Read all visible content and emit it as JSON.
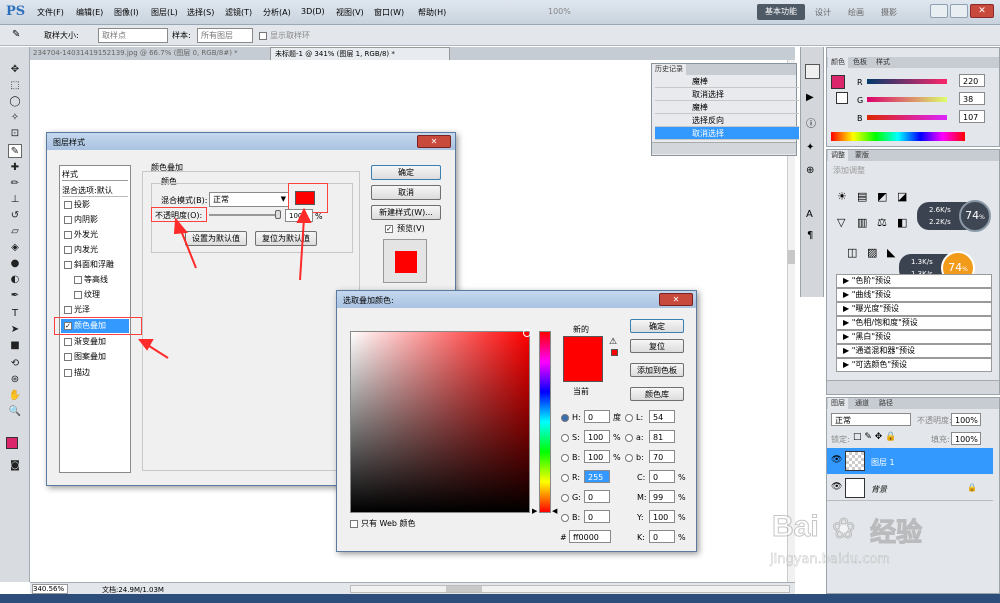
{
  "app": {
    "logo": "PS"
  },
  "menu": [
    "文件(F)",
    "编辑(E)",
    "图像(I)",
    "图层(L)",
    "选择(S)",
    "滤镜(T)",
    "分析(A)",
    "3D(D)",
    "视图(V)",
    "窗口(W)",
    "帮助(H)"
  ],
  "menubar_right": {
    "zoom": "100%",
    "workspaces": [
      "基本功能",
      "设计",
      "绘画",
      "摄影"
    ]
  },
  "options_bar": {
    "sample_size_label": "取样大小:",
    "sample_size_value": "取样点",
    "sample_label": "样本:",
    "sample_value": "所有图层",
    "show_ring": "显示取样环"
  },
  "doc_tabs": [
    "234704-14031419152139.jpg @ 66.7% (图层 0, RGB/8#) *",
    "未标题-1 @ 341% (图层 1, RGB/8) *"
  ],
  "history": {
    "tabs": [
      "历史记录"
    ],
    "items": [
      "魔棒",
      "取消选择",
      "魔棒",
      "选择反向",
      "取消选择"
    ]
  },
  "color_panel": {
    "tabs": [
      "颜色",
      "色板",
      "样式"
    ],
    "r_label": "R",
    "g_label": "G",
    "b_label": "B",
    "r": "220",
    "g": "38",
    "b": "107",
    "fg_color": "#dc266b"
  },
  "adjust_panel": {
    "tabs": [
      "调整",
      "蒙版"
    ],
    "hint": "添加调整",
    "net_up": "2.6K/s",
    "net_down": "2.2K/s",
    "net_up2": "1.3K/s",
    "net_down2": "1.3K/s",
    "pct": "74",
    "pct_sign": "%",
    "presets": [
      "\"色阶\"预设",
      "\"曲线\"预设",
      "\"曝光度\"预设",
      "\"色相/饱和度\"预设",
      "\"黑白\"预设",
      "\"通道混和器\"预设",
      "\"可选颜色\"预设"
    ]
  },
  "layers_panel": {
    "tabs": [
      "图层",
      "通道",
      "路径"
    ],
    "mode": "正常",
    "opacity_label": "不透明度:",
    "opacity": "100%",
    "lock_label": "锁定:",
    "fill_label": "填充:",
    "fill": "100%",
    "layers": [
      "图层 1",
      "背景"
    ]
  },
  "layer_style": {
    "title": "图层样式",
    "style_header": "样式",
    "blend_options": "混合选项:默认",
    "effects": [
      "投影",
      "内阴影",
      "外发光",
      "内发光",
      "斜面和浮雕",
      "等高线",
      "纹理",
      "光泽",
      "颜色叠加",
      "渐变叠加",
      "图案叠加",
      "描边"
    ],
    "section_title": "颜色叠加",
    "color_group": "颜色",
    "blend_mode_label": "混合模式(B):",
    "blend_mode": "正常",
    "opacity_label": "不透明度(O):",
    "opacity": "100",
    "percent": "%",
    "set_default": "设置为默认值",
    "reset_default": "复位为默认值",
    "ok": "确定",
    "cancel": "取消",
    "new_style": "新建样式(W)...",
    "preview": "预览(V)",
    "overlay_color": "#ff0000"
  },
  "color_picker": {
    "title": "选取叠加颜色:",
    "new_label": "新的",
    "current_label": "当前",
    "ok": "确定",
    "reset": "复位",
    "add_swatch": "添加到色板",
    "libraries": "颜色库",
    "web_only": "只有 Web 颜色",
    "h_label": "H:",
    "h": "0",
    "h_unit": "度",
    "s_label": "S:",
    "s": "100",
    "s_unit": "%",
    "b_label": "B:",
    "b": "100",
    "b_unit": "%",
    "r_label": "R:",
    "r": "255",
    "g_label": "G:",
    "g": "0",
    "bb_label": "B:",
    "bb": "0",
    "l_label": "L:",
    "l": "54",
    "a_label": "a:",
    "a": "81",
    "b2_label": "b:",
    "b2": "70",
    "c_label": "C:",
    "c": "0",
    "m_label": "M:",
    "m": "99",
    "y_label": "Y:",
    "y": "100",
    "k_label": "K:",
    "k": "0",
    "hex_label": "#",
    "hex": "ff0000",
    "new_color": "#ff0000",
    "current_color": "#ff0000"
  },
  "status": {
    "zoom": "340.56%",
    "doc": "文档:24.9M/1.03M"
  },
  "watermark": {
    "line1": "Bai",
    "line2": "经验",
    "url": "jingyan.baidu.com"
  }
}
